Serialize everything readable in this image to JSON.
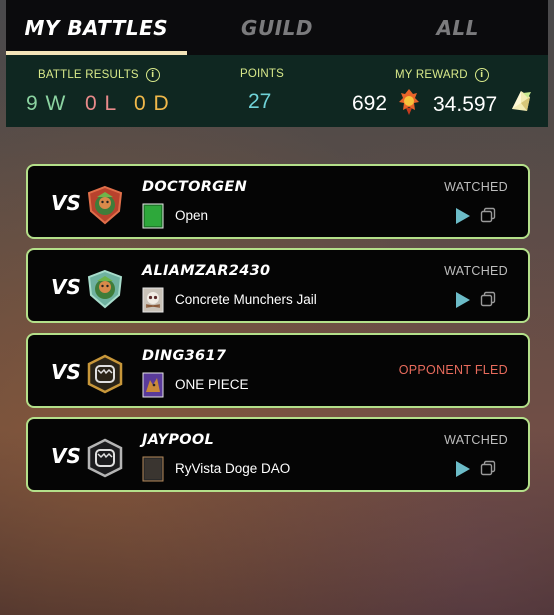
{
  "tabs": [
    {
      "label": "MY BATTLES",
      "active": true
    },
    {
      "label": "GUILD",
      "active": false
    },
    {
      "label": "ALL",
      "active": false
    }
  ],
  "summary": {
    "battle_results_label": "BATTLE RESULTS",
    "wins": "9 W",
    "losses": "0 L",
    "draws": "0 D",
    "points_label": "POINTS",
    "points": "27",
    "reward_label": "MY REWARD",
    "reward_dec": "692",
    "reward_sps": "34.597",
    "info_icon": "i"
  },
  "battles": [
    {
      "vs": "VS",
      "opponent": "DOCTORGEN",
      "guild": "Open",
      "status": "WATCHED",
      "avatar_icon": "red-shield-character-avatar-icon",
      "guild_icon": "green-banner-icon"
    },
    {
      "vs": "VS",
      "opponent": "ALIAMZAR2430",
      "guild": "Concrete Munchers Jail",
      "status": "WATCHED",
      "avatar_icon": "green-shield-character-avatar-icon",
      "guild_icon": "skull-banner-icon"
    },
    {
      "vs": "VS",
      "opponent": "DING3617",
      "guild": "ONE PIECE",
      "status": "OPPONENT FLED",
      "avatar_icon": "gold-shield-avatar-icon",
      "guild_icon": "purple-wolf-banner-icon"
    },
    {
      "vs": "VS",
      "opponent": "JAYPOOL",
      "guild": "RyVista Doge DAO",
      "status": "WATCHED",
      "avatar_icon": "silver-shield-avatar-icon",
      "guild_icon": "dark-banner-icon"
    }
  ],
  "colors": {
    "card_border": "#b4e08a",
    "summary_bg": "#0f2721",
    "summary_label": "#d8e98a",
    "win": "#8bd3a1",
    "loss": "#e88a8a",
    "draw": "#f0b84a",
    "points": "#6fd3d8",
    "fled": "#e86b5c"
  }
}
